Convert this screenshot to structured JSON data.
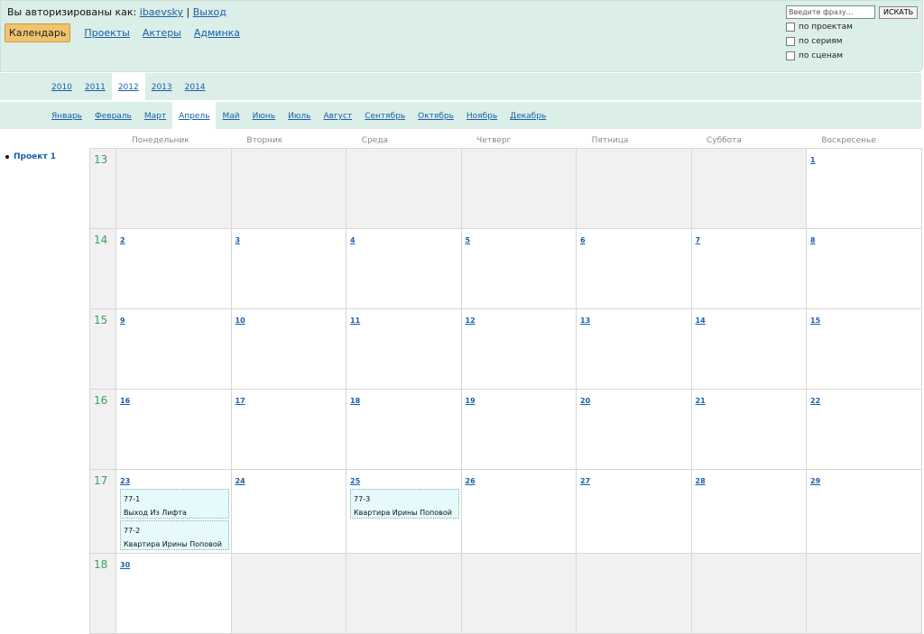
{
  "auth": {
    "prefix": "Вы авторизированы как:",
    "user": "ibaevsky",
    "sep": "|",
    "logout": "Выход"
  },
  "nav": {
    "active": "Календарь",
    "items": [
      "Проекты",
      "Актеры",
      "Админка"
    ]
  },
  "search": {
    "placeholder": "Введите фразу...",
    "button": "ИСКАТЬ",
    "options": [
      "по проектам",
      "по сериям",
      "по сценам"
    ]
  },
  "years": {
    "items": [
      "2010",
      "2011",
      "2012",
      "2013",
      "2014"
    ],
    "active_index": 2
  },
  "months": {
    "items": [
      "Январь",
      "Февраль",
      "Март",
      "Апрель",
      "Май",
      "Июнь",
      "Июль",
      "Август",
      "Сентябрь",
      "Октябрь",
      "Ноябрь",
      "Декабрь"
    ],
    "active_index": 3
  },
  "sidebar": {
    "projects": [
      "Проект 1"
    ]
  },
  "weekdays": [
    "Понедельник",
    "Вторник",
    "Среда",
    "Четверг",
    "Пятница",
    "Суббота",
    "Воскресенье"
  ],
  "weeks": [
    {
      "num": "13",
      "days": [
        "",
        "",
        "",
        "",
        "",
        "",
        "1"
      ]
    },
    {
      "num": "14",
      "days": [
        "2",
        "3",
        "4",
        "5",
        "6",
        "7",
        "8"
      ]
    },
    {
      "num": "15",
      "days": [
        "9",
        "10",
        "11",
        "12",
        "13",
        "14",
        "15"
      ]
    },
    {
      "num": "16",
      "days": [
        "16",
        "17",
        "18",
        "19",
        "20",
        "21",
        "22"
      ]
    },
    {
      "num": "17",
      "days": [
        "23",
        "24",
        "25",
        "26",
        "27",
        "28",
        "29"
      ]
    },
    {
      "num": "18",
      "days": [
        "30",
        "",
        "",
        "",
        "",
        "",
        ""
      ]
    }
  ],
  "events": [
    {
      "day": "23",
      "code": "77-1",
      "title": "Выход Из Лифта"
    },
    {
      "day": "23",
      "code": "77-2",
      "title": "Квартира Ирины Поповой"
    },
    {
      "day": "25",
      "code": "77-3",
      "title": "Квартира Ирины Поповой"
    }
  ]
}
